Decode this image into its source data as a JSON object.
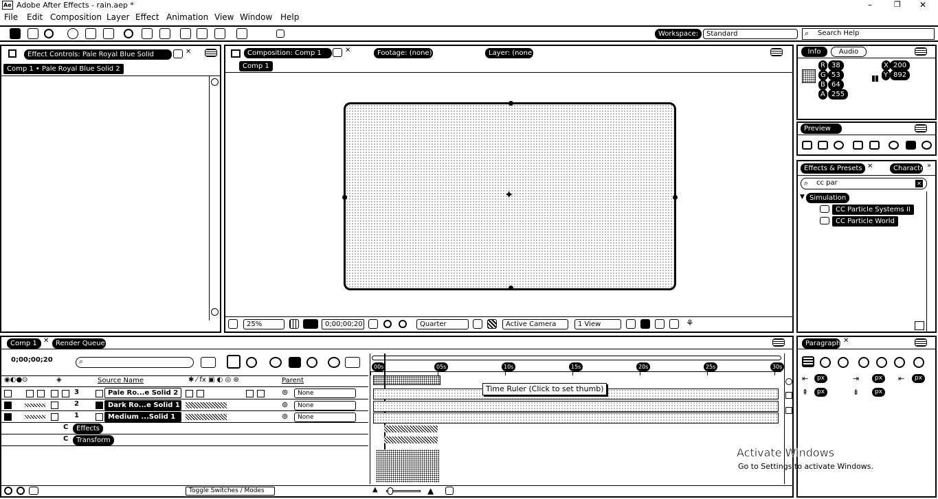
{
  "title_bar": {
    "app_icon": "Ae",
    "title": "Adobe After Effects - rain.aep *"
  },
  "window_controls": {
    "minimize": "–",
    "maximize": "❐",
    "close": "✕"
  },
  "menu": [
    "File",
    "Edit",
    "Composition",
    "Layer",
    "Effect",
    "Animation",
    "View",
    "Window",
    "Help"
  ],
  "toolbar": {
    "workspace_label": "Workspace:",
    "workspace_value": "Standard",
    "search_placeholder": "Search Help"
  },
  "effect_controls": {
    "tab": "Effect Controls: Pale Royal Blue Solid",
    "breadcrumb": "Comp 1 • Pale Royal Blue Solid 2"
  },
  "composition_panel": {
    "tab_comp": "Composition: Comp 1",
    "tab_footage": "Footage: (none)",
    "tab_layer": "Layer: (none)",
    "comp_button": "Comp 1",
    "bottom_bar": {
      "zoom": "25%",
      "timecode": "0;00;00;20",
      "resolution": "Quarter",
      "camera": "Active Camera",
      "views": "1 View"
    }
  },
  "info_panel": {
    "tab_info": "Info",
    "tab_audio": "Audio",
    "r_label": "R",
    "r": "38",
    "g_label": "G",
    "g": "53",
    "b_label": "B",
    "b": "64",
    "a_label": "A",
    "a": "255",
    "x_label": "X",
    "x": "200",
    "y_label": "Y",
    "y": "892"
  },
  "preview_panel": {
    "tab": "Preview"
  },
  "effects_presets": {
    "tab": "Effects & Presets",
    "tab_character": "Character",
    "search_value": "cc par",
    "category": "Simulation",
    "items": [
      "CC Particle Systems II",
      "CC Particle World"
    ]
  },
  "paragraph_panel": {
    "tab": "Paragraph",
    "indent_values": [
      "px",
      "px",
      "px",
      "px",
      "px"
    ]
  },
  "timeline": {
    "tab_comp": "Comp 1",
    "tab_render": "Render Queue",
    "timecode": "0;00;00;20",
    "column_source": "Source Name",
    "column_parent": "Parent",
    "layers": [
      {
        "num": "3",
        "name": "Pale Ro...e Solid 2",
        "parent": "None"
      },
      {
        "num": "2",
        "name": "Dark Ro...e Solid 1",
        "parent": "None"
      },
      {
        "num": "1",
        "name": "Medium ...Solid 1",
        "parent": "None"
      }
    ],
    "sub_effects": "Effects",
    "sub_transform": "Transform",
    "sub_effects_letter": "C",
    "sub_transform_letter": "C",
    "ruler_labels": [
      "00s",
      "05s",
      "10s",
      "15s",
      "20s",
      "25s",
      "30s"
    ],
    "tooltip": "Time Ruler (Click to set thumb)",
    "toggle_button": "Toggle Switches / Modes"
  },
  "watermark": {
    "line1": "Activate Windows",
    "line2": "Go to Settings to activate Windows."
  }
}
